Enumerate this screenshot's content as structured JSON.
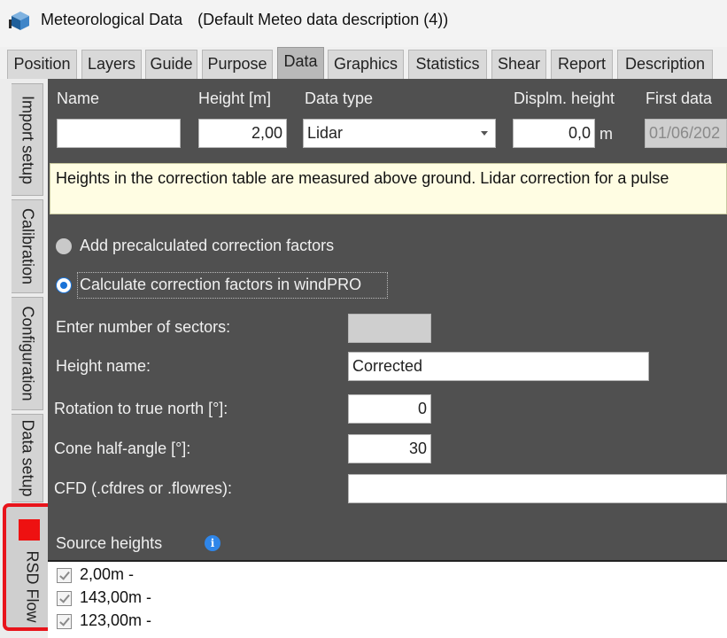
{
  "window": {
    "title": "Meteorological Data",
    "subtitle": "(Default Meteo data description (4))"
  },
  "tabs": [
    {
      "label": "Position"
    },
    {
      "label": "Layers"
    },
    {
      "label": "Guide"
    },
    {
      "label": "Purpose"
    },
    {
      "label": "Data",
      "active": true
    },
    {
      "label": "Graphics"
    },
    {
      "label": "Statistics"
    },
    {
      "label": "Shear"
    },
    {
      "label": "Report"
    },
    {
      "label": "Description"
    }
  ],
  "side_tabs": [
    {
      "label": "Import setup"
    },
    {
      "label": "Calibration"
    },
    {
      "label": "Configuration"
    },
    {
      "label": "Data setup"
    },
    {
      "label": "RSD Flow",
      "active": true
    }
  ],
  "accent": {
    "highlight": "#e8141b",
    "radio": "#1a73d8",
    "info": "#2f86e9"
  },
  "header": {
    "name_label": "Name",
    "name_value": "",
    "height_label": "Height [m]",
    "height_value": "2,00",
    "datatype_label": "Data type",
    "datatype_value": "Lidar",
    "displ_label": "Displm. height",
    "displ_value": "0,0",
    "displ_unit": "m",
    "firstdata_label": "First data",
    "firstdata_value": "01/06/202"
  },
  "info_text": "Heights in the correction table are measured above ground. Lidar correction for a pulse",
  "options": {
    "precalc_label": "Add precalculated correction factors",
    "precalc_selected": false,
    "calc_label": "Calculate correction factors in windPRO",
    "calc_selected": true
  },
  "form": {
    "sectors_label": "Enter number of sectors:",
    "sectors_value": "",
    "height_name_label": "Height name:",
    "height_name_value": "Corrected",
    "rotation_label": "Rotation to true north [°]:",
    "rotation_value": "0",
    "cone_label": "Cone half-angle [°]:",
    "cone_value": "30",
    "cfd_label": "CFD (.cfdres or .flowres):",
    "cfd_value": ""
  },
  "source_heights": {
    "label": "Source heights",
    "info_icon": "i",
    "items": [
      {
        "label": "2,00m -",
        "checked": true
      },
      {
        "label": "143,00m -",
        "checked": true
      },
      {
        "label": "123,00m -",
        "checked": true
      }
    ]
  }
}
